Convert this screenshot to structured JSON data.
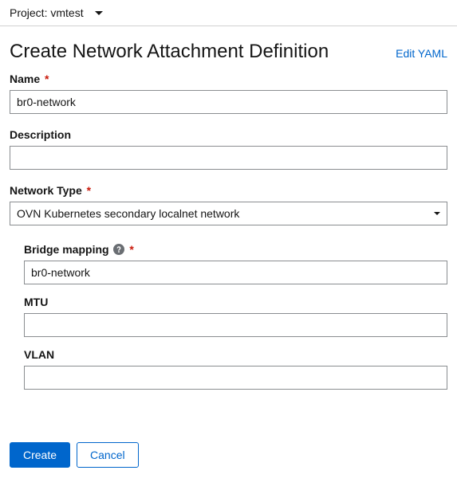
{
  "project": {
    "label": "Project: vmtest"
  },
  "page": {
    "title": "Create Network Attachment Definition",
    "edit_yaml": "Edit YAML"
  },
  "form": {
    "name": {
      "label": "Name",
      "value": "br0-network"
    },
    "description": {
      "label": "Description",
      "value": ""
    },
    "network_type": {
      "label": "Network Type",
      "value": "OVN Kubernetes secondary localnet network"
    },
    "bridge_mapping": {
      "label": "Bridge mapping",
      "value": "br0-network"
    },
    "mtu": {
      "label": "MTU",
      "value": ""
    },
    "vlan": {
      "label": "VLAN",
      "value": ""
    }
  },
  "actions": {
    "create": "Create",
    "cancel": "Cancel"
  }
}
